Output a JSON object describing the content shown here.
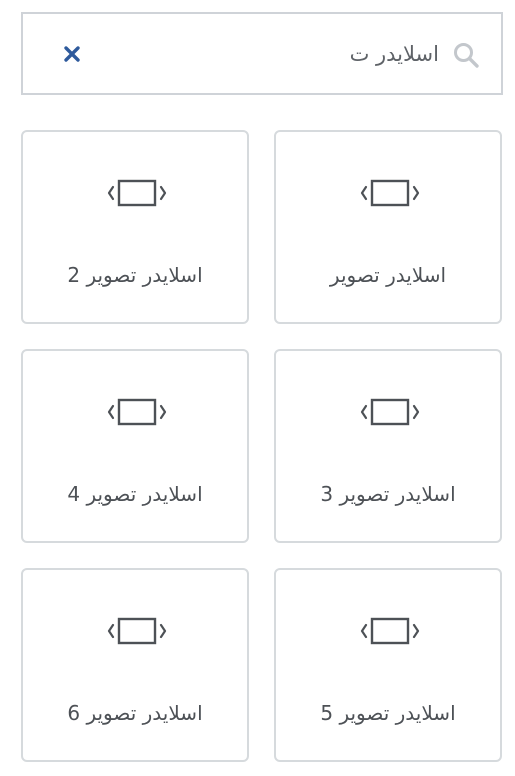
{
  "search": {
    "value": "اسلایدر ت",
    "clear_icon": "close-icon",
    "search_icon": "search-icon"
  },
  "widgets": [
    {
      "label": "اسلایدر تصویر",
      "icon": "slider-icon"
    },
    {
      "label": "اسلایدر تصویر 2",
      "icon": "slider-icon"
    },
    {
      "label": "اسلایدر تصویر 3",
      "icon": "slider-icon"
    },
    {
      "label": "اسلایدر تصویر 4",
      "icon": "slider-icon"
    },
    {
      "label": "اسلایدر تصویر 5",
      "icon": "slider-icon"
    },
    {
      "label": "اسلایدر تصویر 6",
      "icon": "slider-icon"
    }
  ],
  "colors": {
    "clear_icon": "#2e5a9c",
    "border": "#d6dadd",
    "text": "#4d5156",
    "icon": "#4d5156"
  }
}
